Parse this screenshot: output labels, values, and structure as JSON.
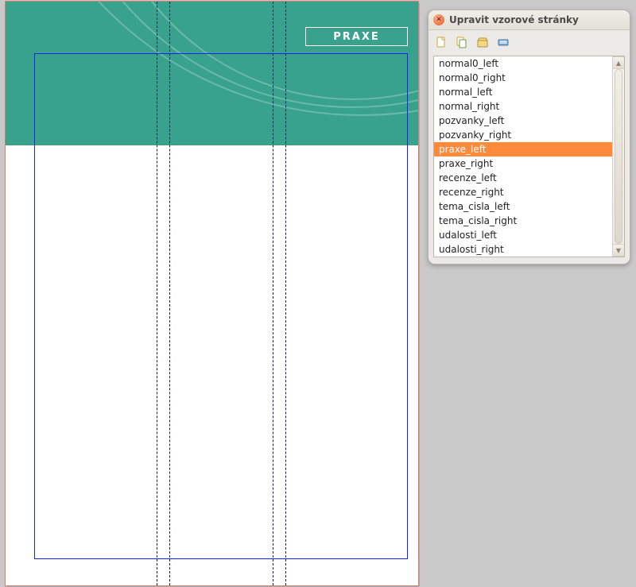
{
  "doc": {
    "header_label": "PRAXE"
  },
  "dialog": {
    "title": "Upravit vzorové stránky",
    "toolbar": {
      "new": "new-master-icon",
      "duplicate": "duplicate-master-icon",
      "import": "import-master-icon",
      "delete": "delete-master-icon"
    },
    "selected_index": 6,
    "items": [
      "normal0_left",
      "normal0_right",
      "normal_left",
      "normal_right",
      "pozvanky_left",
      "pozvanky_right",
      "praxe_left",
      "praxe_right",
      "recenze_left",
      "recenze_right",
      "tema_cisla_left",
      "tema_cisla_right",
      "udalosti_left",
      "udalosti_right"
    ]
  }
}
